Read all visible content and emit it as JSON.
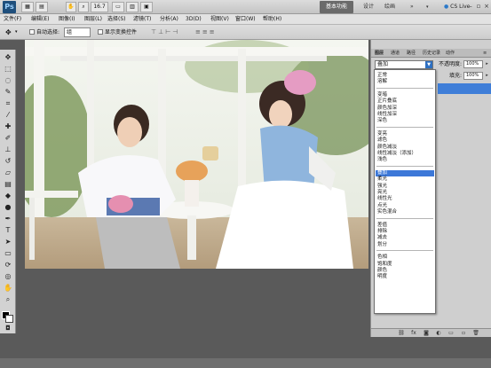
{
  "app": {
    "logo": "Ps",
    "zoom": "16.7",
    "workspaces": {
      "active": "基本功能",
      "design": "设计",
      "painting": "绘画"
    },
    "cs_live": "CS Live"
  },
  "menu": [
    "文件(F)",
    "编辑(E)",
    "图像(I)",
    "图层(L)",
    "选择(S)",
    "滤镜(T)",
    "分析(A)",
    "3D(D)",
    "视图(V)",
    "窗口(W)",
    "帮助(H)"
  ],
  "options": {
    "auto_select_label": "自动选择:",
    "auto_select_value": "组",
    "show_transform_label": "显示变换控件"
  },
  "panel": {
    "tabs": [
      "图层",
      "通道",
      "路径",
      "历史记录",
      "动作"
    ],
    "blend_mode": "叠加",
    "opacity_label": "不透明度:",
    "opacity_value": "100%",
    "fill_label": "填充:",
    "fill_value": "100%"
  },
  "blend_list": [
    [
      "正常",
      "溶解"
    ],
    [
      "变暗",
      "正片叠底",
      "颜色加深",
      "线性加深",
      "深色"
    ],
    [
      "变亮",
      "滤色",
      "颜色减淡",
      "线性减淡（添加）",
      "浅色"
    ],
    [
      "叠加",
      "柔光",
      "强光",
      "亮光",
      "线性光",
      "点光",
      "实色混合"
    ],
    [
      "差值",
      "排除",
      "减去",
      "划分"
    ],
    [
      "色相",
      "饱和度",
      "颜色",
      "明度"
    ]
  ],
  "blend_selected": "叠加"
}
